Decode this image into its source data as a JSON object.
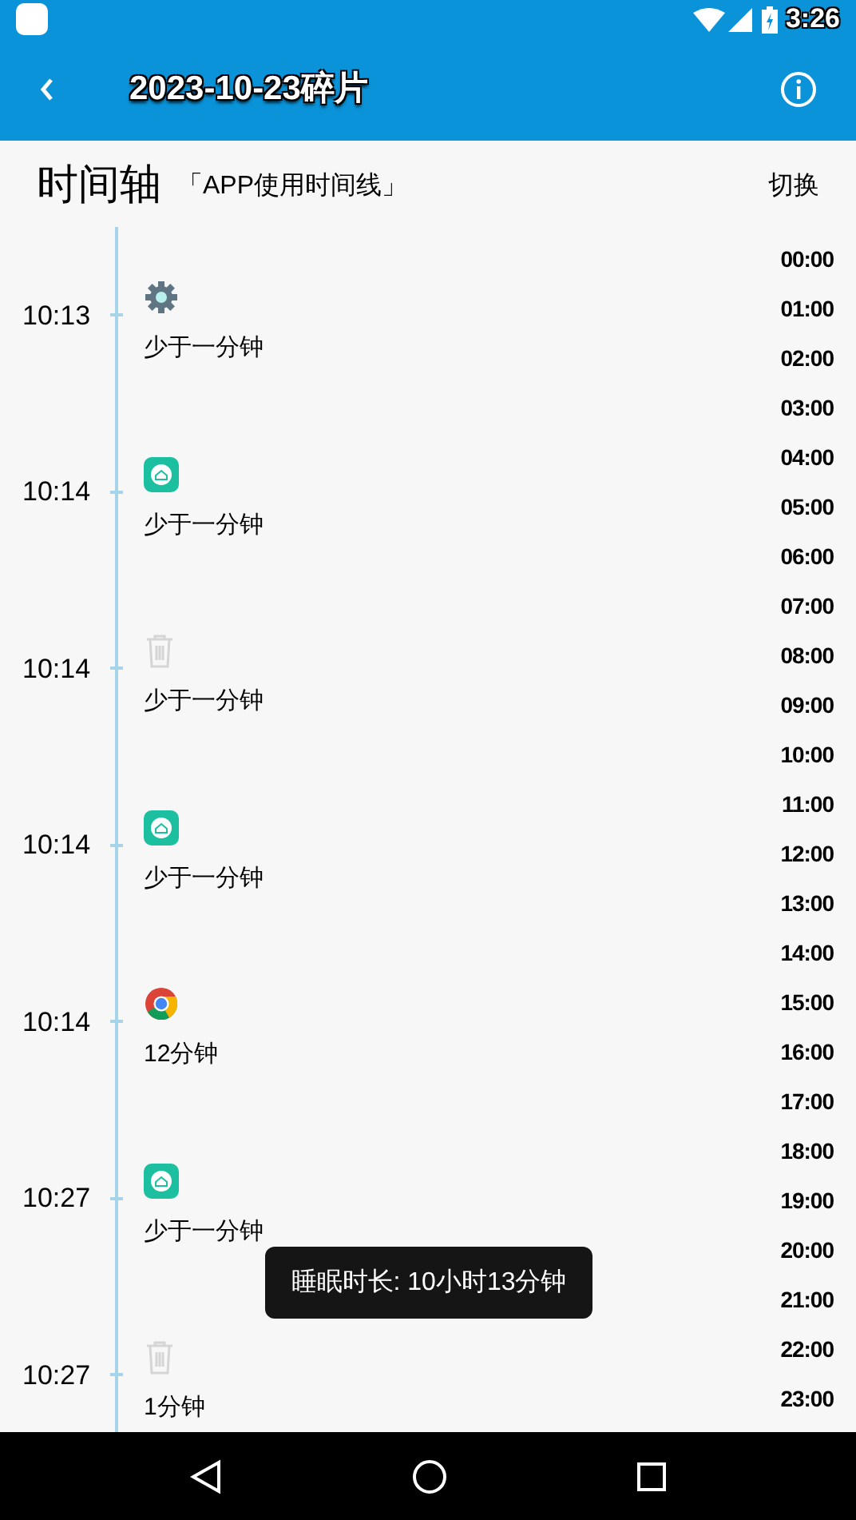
{
  "status_bar": {
    "time": "3:26"
  },
  "app_bar": {
    "title": "2023-10-23碎片"
  },
  "header": {
    "title": "时间轴",
    "subtitle": "「APP使用时间线」",
    "switch": "切换"
  },
  "events": [
    {
      "time": "10:13",
      "kind": "settings",
      "duration": "少于一分钟"
    },
    {
      "time": "10:14",
      "kind": "home",
      "duration": "少于一分钟"
    },
    {
      "time": "10:14",
      "kind": "trash",
      "duration": "少于一分钟"
    },
    {
      "time": "10:14",
      "kind": "home",
      "duration": "少于一分钟"
    },
    {
      "time": "10:14",
      "kind": "browser",
      "duration": "12分钟"
    },
    {
      "time": "10:27",
      "kind": "home",
      "duration": "少于一分钟"
    },
    {
      "time": "10:27",
      "kind": "trash",
      "duration": "1分钟"
    }
  ],
  "hours": [
    "00:00",
    "01:00",
    "02:00",
    "03:00",
    "04:00",
    "05:00",
    "06:00",
    "07:00",
    "08:00",
    "09:00",
    "10:00",
    "11:00",
    "12:00",
    "13:00",
    "14:00",
    "15:00",
    "16:00",
    "17:00",
    "18:00",
    "19:00",
    "20:00",
    "21:00",
    "22:00",
    "23:00"
  ],
  "toast": "睡眠时长: 10小时13分钟"
}
